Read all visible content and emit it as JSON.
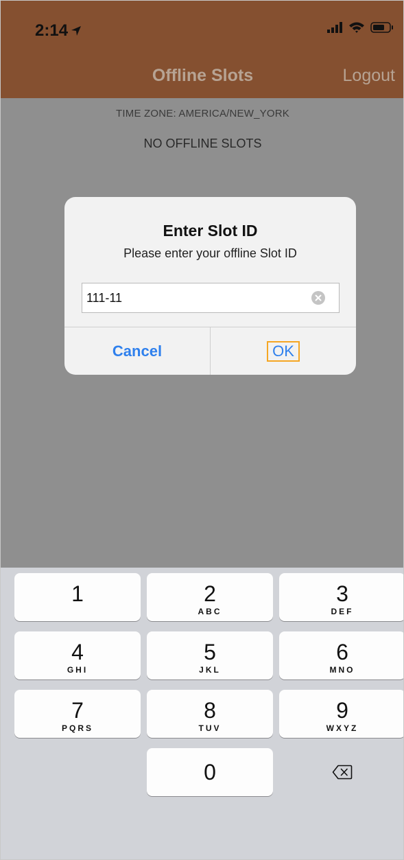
{
  "status_bar": {
    "time": "2:14"
  },
  "nav": {
    "title": "Offline Slots",
    "logout_label": "Logout",
    "background": "#855030"
  },
  "content": {
    "time_zone": "TIME ZONE: AMERICA/NEW_YORK",
    "empty_message": "NO OFFLINE SLOTS"
  },
  "alert": {
    "title": "Enter Slot ID",
    "message": "Please enter your offline Slot ID",
    "input_value": "111-11",
    "cancel_label": "Cancel",
    "ok_label": "OK",
    "accent": "#2f80ed"
  },
  "keypad": {
    "keys": [
      {
        "digit": "1",
        "letters": ""
      },
      {
        "digit": "2",
        "letters": "ABC"
      },
      {
        "digit": "3",
        "letters": "DEF"
      },
      {
        "digit": "4",
        "letters": "GHI"
      },
      {
        "digit": "5",
        "letters": "JKL"
      },
      {
        "digit": "6",
        "letters": "MNO"
      },
      {
        "digit": "7",
        "letters": "PQRS"
      },
      {
        "digit": "8",
        "letters": "TUV"
      },
      {
        "digit": "9",
        "letters": "WXYZ"
      },
      {
        "digit": "0",
        "letters": ""
      }
    ],
    "delete_icon": "backspace-icon"
  }
}
